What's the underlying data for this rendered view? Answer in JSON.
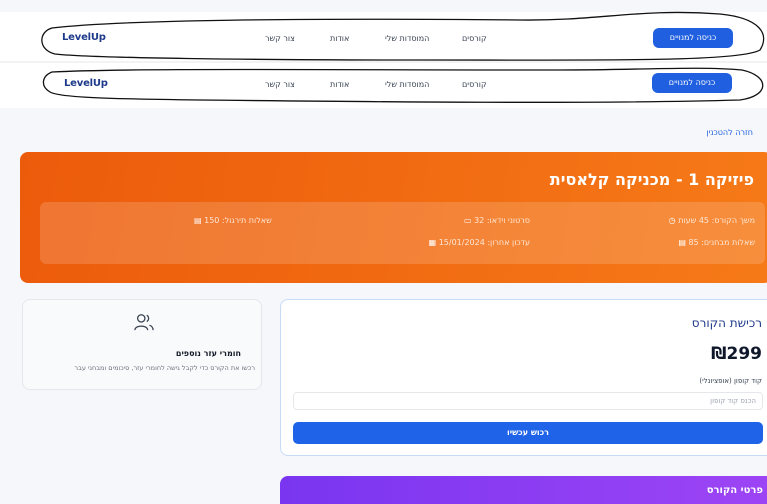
{
  "navbar": {
    "logo": "LevelUp",
    "links": [
      "קורסים",
      "המוסדות שלי",
      "אודות",
      "צור קשר"
    ],
    "cta": "כניסה למנויים"
  },
  "back_link": "חזרה להטכנין",
  "course": {
    "title": "פיזיקה 1 - מכניקה קלאסית",
    "duration": "משך הקורס: 45 שעות",
    "videos": "סרטוני וידאו: 32",
    "practice": "שאלות תירגול: 150",
    "exam_questions": "שאלות מבחנים: 85",
    "last_update": "עדכון אחרון: 15/01/2024"
  },
  "materials": {
    "title": "חומרי עזר נוספים",
    "description": "רכשו את הקורס כדי לקבל גישה לחומרי עזר, סיכומים ומבחני עבר"
  },
  "purchase": {
    "title": "רכישת הקורס",
    "price": "₪299",
    "coupon_label": "קוד קופון (אופציונלי)",
    "coupon_placeholder": "הכנס קוד קופון",
    "buy_button": "רכוש עכשיו"
  },
  "details": {
    "title": "פרטי הקורס"
  },
  "colors": {
    "primary": "#1f5fe0",
    "hero_orange": "#f06414",
    "details_purple": "#8b3cf3"
  },
  "icons": [
    "clock-icon",
    "video-icon",
    "document-icon",
    "calendar-icon",
    "people-icon"
  ]
}
